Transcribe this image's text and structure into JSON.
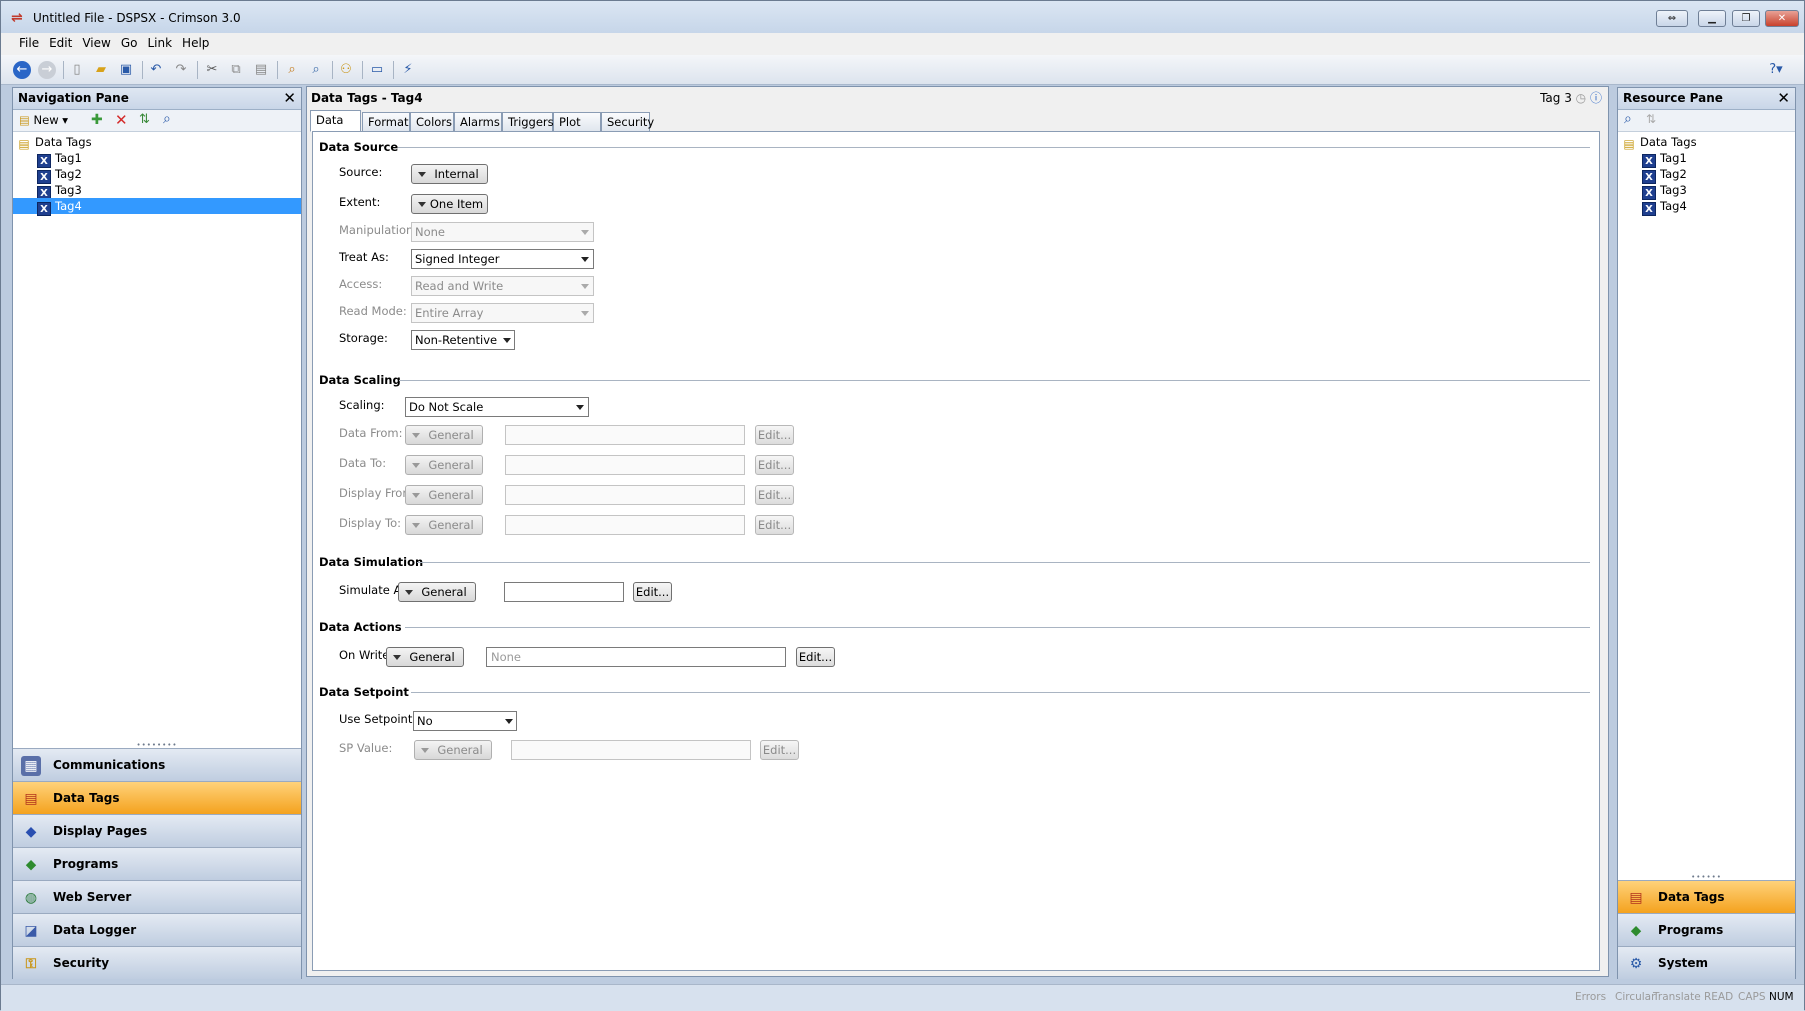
{
  "window": {
    "title": "Untitled File - DSPSX - Crimson 3.0",
    "app_icon": "crimson-app-icon"
  },
  "menu": [
    "File",
    "Edit",
    "View",
    "Go",
    "Link",
    "Help"
  ],
  "toolbar_icons": [
    "back-icon",
    "forward-icon",
    "new-file-icon",
    "open-icon",
    "save-icon",
    "undo-icon",
    "redo-icon",
    "cut-icon",
    "copy-icon",
    "paste-icon",
    "find-icon",
    "find-replace-icon",
    "link-icon",
    "window-icon",
    "transfer-icon",
    "help-icon"
  ],
  "nav": {
    "title": "Navigation Pane",
    "new_label": "New",
    "tree_root": "Data Tags",
    "tags": [
      "Tag1",
      "Tag2",
      "Tag3",
      "Tag4"
    ],
    "selected": "Tag4",
    "categories": [
      "Communications",
      "Data Tags",
      "Display Pages",
      "Programs",
      "Web Server",
      "Data Logger",
      "Security"
    ],
    "active_category": "Data Tags"
  },
  "editor": {
    "title": "Data Tags - Tag4",
    "nav_label": "Tag 3",
    "tabs": [
      "Data",
      "Format",
      "Colors",
      "Alarms",
      "Triggers",
      "Plot",
      "Security"
    ],
    "active_tab": "Data",
    "data_source": {
      "heading": "Data Source",
      "source_label": "Source:",
      "source_value": "Internal",
      "extent_label": "Extent:",
      "extent_value": "One Item",
      "manipulation_label": "Manipulation:",
      "manipulation_value": "None",
      "treat_as_label": "Treat As:",
      "treat_as_value": "Signed Integer",
      "access_label": "Access:",
      "access_value": "Read and Write",
      "read_mode_label": "Read Mode:",
      "read_mode_value": "Entire Array",
      "storage_label": "Storage:",
      "storage_value": "Non-Retentive"
    },
    "data_scaling": {
      "heading": "Data Scaling",
      "scaling_label": "Scaling:",
      "scaling_value": "Do Not Scale",
      "rows": [
        {
          "label": "Data From:",
          "type": "General",
          "edit": "Edit..."
        },
        {
          "label": "Data To:",
          "type": "General",
          "edit": "Edit..."
        },
        {
          "label": "Display From:",
          "type": "General",
          "edit": "Edit..."
        },
        {
          "label": "Display To:",
          "type": "General",
          "edit": "Edit..."
        }
      ]
    },
    "data_simulation": {
      "heading": "Data Simulation",
      "label": "Simulate As:",
      "type": "General",
      "value": "",
      "edit": "Edit..."
    },
    "data_actions": {
      "heading": "Data Actions",
      "label": "On Write:",
      "type": "General",
      "placeholder": "None",
      "edit": "Edit..."
    },
    "data_setpoint": {
      "heading": "Data Setpoint",
      "use_label": "Use Setpoint:",
      "use_value": "No",
      "sp_label": "SP Value:",
      "sp_type": "General",
      "edit": "Edit..."
    }
  },
  "resource": {
    "title": "Resource Pane",
    "tree_root": "Data Tags",
    "tags": [
      "Tag1",
      "Tag2",
      "Tag3",
      "Tag4"
    ],
    "categories": [
      "Data Tags",
      "Programs",
      "System"
    ],
    "active_category": "Data Tags"
  },
  "status": {
    "items": [
      "Errors",
      "Circular",
      "Translate",
      "READ",
      "CAPS",
      "NUM"
    ],
    "active": "NUM"
  }
}
